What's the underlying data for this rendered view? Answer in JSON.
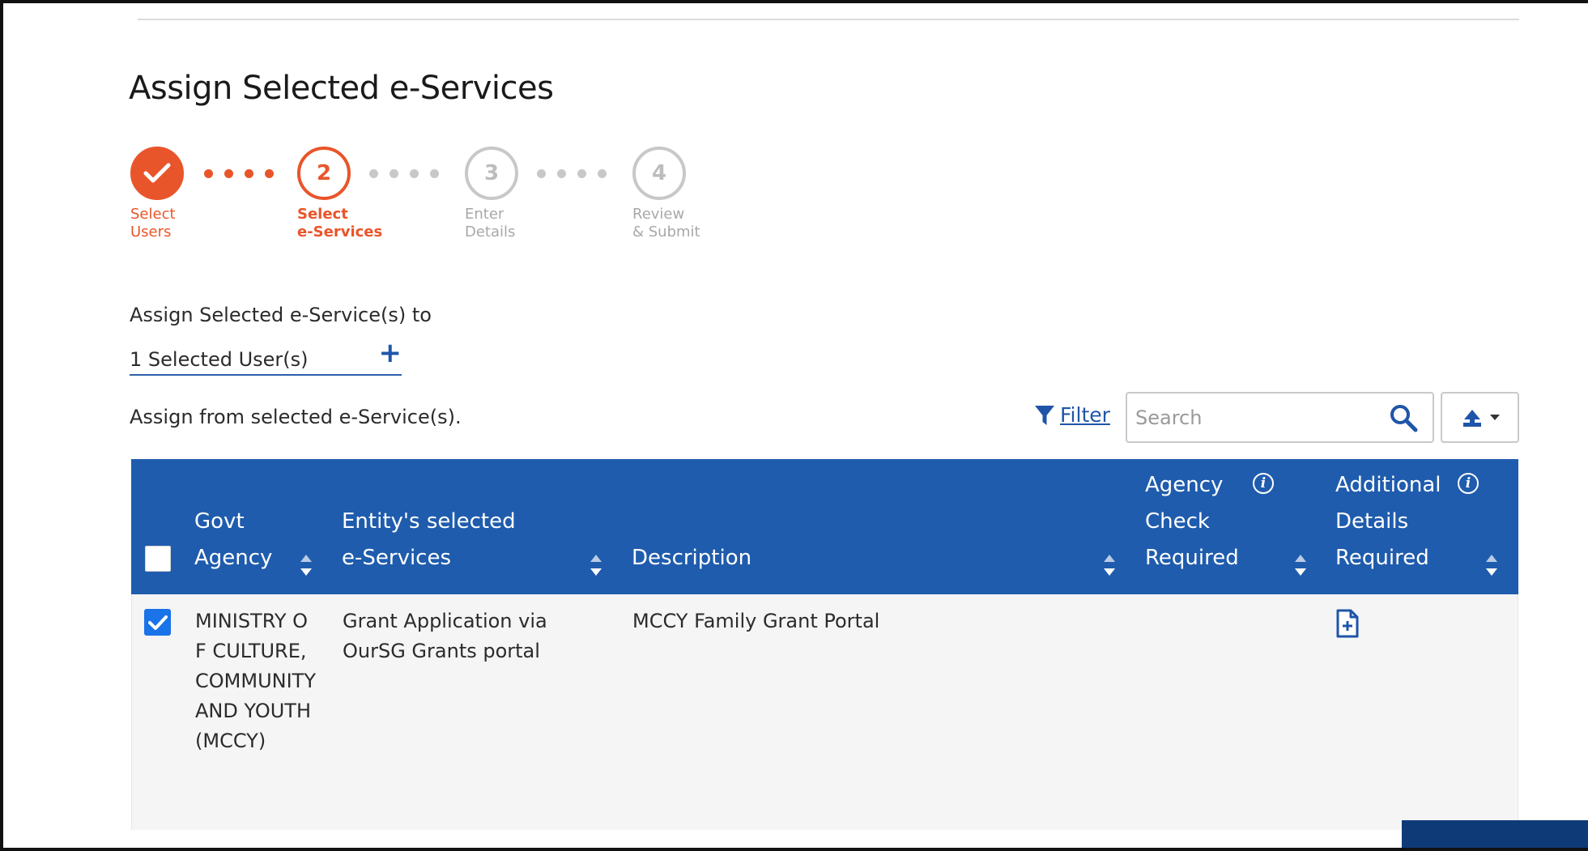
{
  "page": {
    "title": "Assign Selected e-Services"
  },
  "stepper": {
    "steps": [
      {
        "number": "",
        "label_line1": "Select",
        "label_line2": "Users",
        "state": "done"
      },
      {
        "number": "2",
        "label_line1": "Select",
        "label_line2": "e-Services",
        "state": "active"
      },
      {
        "number": "3",
        "label_line1": "Enter",
        "label_line2": "Details",
        "state": "todo"
      },
      {
        "number": "4",
        "label_line1": "Review",
        "label_line2": "& Submit",
        "state": "todo"
      }
    ]
  },
  "assign": {
    "to_label": "Assign Selected e-Service(s) to",
    "users_value": "1 Selected User(s)",
    "add_symbol": "+",
    "from_label": "Assign from selected e-Service(s)."
  },
  "toolbar": {
    "filter_label": "Filter",
    "search_placeholder": "Search",
    "icons": {
      "filter": "filter-icon",
      "search": "search-icon",
      "export": "export-icon"
    }
  },
  "table": {
    "headers": {
      "agency": [
        "Govt",
        "Agency"
      ],
      "service": [
        "Entity's selected",
        "e-Services"
      ],
      "description": [
        "Description"
      ],
      "check": [
        "Agency",
        "Check",
        "Required"
      ],
      "details": [
        "Additional",
        "Details",
        "Required"
      ]
    },
    "info_symbol": "i",
    "rows": [
      {
        "checked": true,
        "agency": "MINISTRY OF CULTURE, COMMUNITY AND YOUTH (MCCY)",
        "service": "Grant Application via OurSG Grants portal",
        "description": "MCCY Family Grant Portal",
        "details_icon": "add-document-icon"
      }
    ]
  },
  "colors": {
    "accent_orange": "#e9552a",
    "header_blue": "#1f5cad",
    "link_blue": "#1f55a8",
    "checkbox_blue": "#1a73e8"
  }
}
